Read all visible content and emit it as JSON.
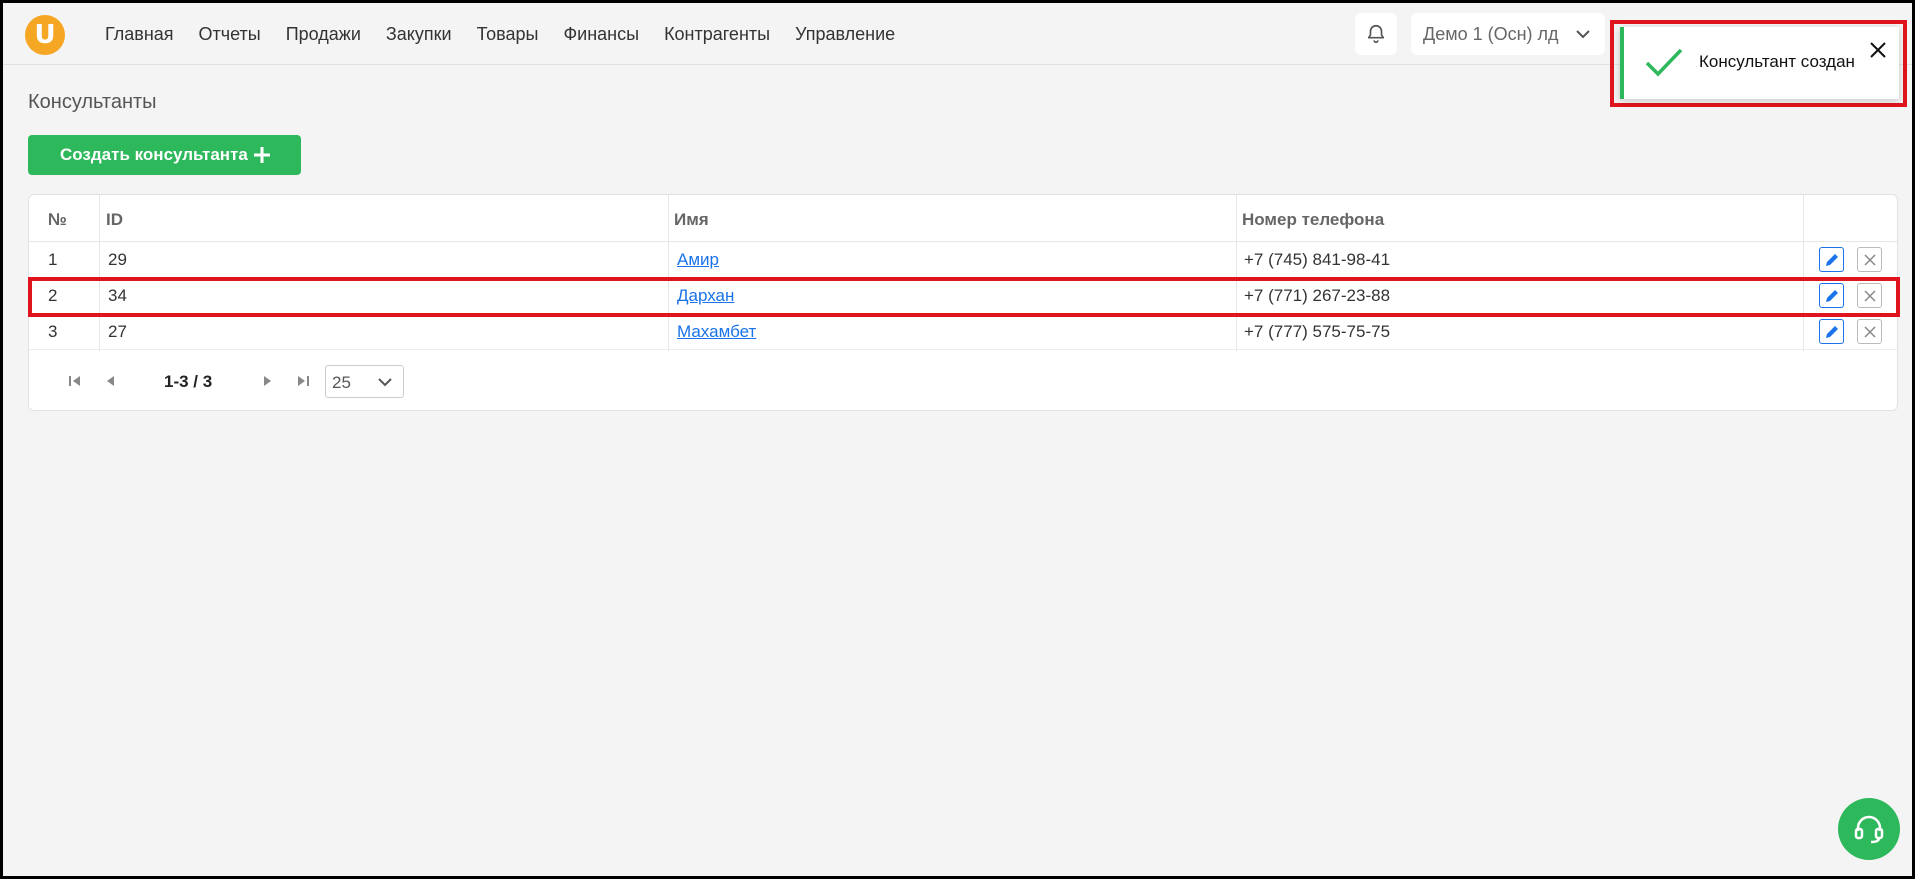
{
  "nav": {
    "items": [
      "Главная",
      "Отчеты",
      "Продажи",
      "Закупки",
      "Товары",
      "Финансы",
      "Контрагенты",
      "Управление"
    ]
  },
  "header": {
    "company": "Демо 1 (Осн) лд"
  },
  "toast": {
    "message": "Консультант создан"
  },
  "page": {
    "title": "Консультанты",
    "create_button": "Создать консультанта"
  },
  "table": {
    "headers": [
      "№",
      "ID",
      "Имя",
      "Номер телефона"
    ],
    "rows": [
      {
        "num": "1",
        "id": "29",
        "name": "Амир",
        "phone": "+7 (745) 841-98-41"
      },
      {
        "num": "2",
        "id": "34",
        "name": "Дархан",
        "phone": "+7 (771) 267-23-88"
      },
      {
        "num": "3",
        "id": "27",
        "name": "Махамбет",
        "phone": "+7 (777) 575-75-75"
      }
    ]
  },
  "pager": {
    "range": "1-3 / 3",
    "page_size": "25"
  },
  "icons": {
    "logo": "logo-icon",
    "bell": "bell-icon",
    "check": "check-icon",
    "close": "close-icon",
    "plus": "plus-icon",
    "edit": "pencil-icon",
    "delete": "x-icon",
    "support": "headset-icon"
  },
  "colors": {
    "accent_green": "#2eb85c",
    "logo_orange": "#f5a623",
    "link_blue": "#1a73e8",
    "highlight_red": "#e0141e"
  }
}
